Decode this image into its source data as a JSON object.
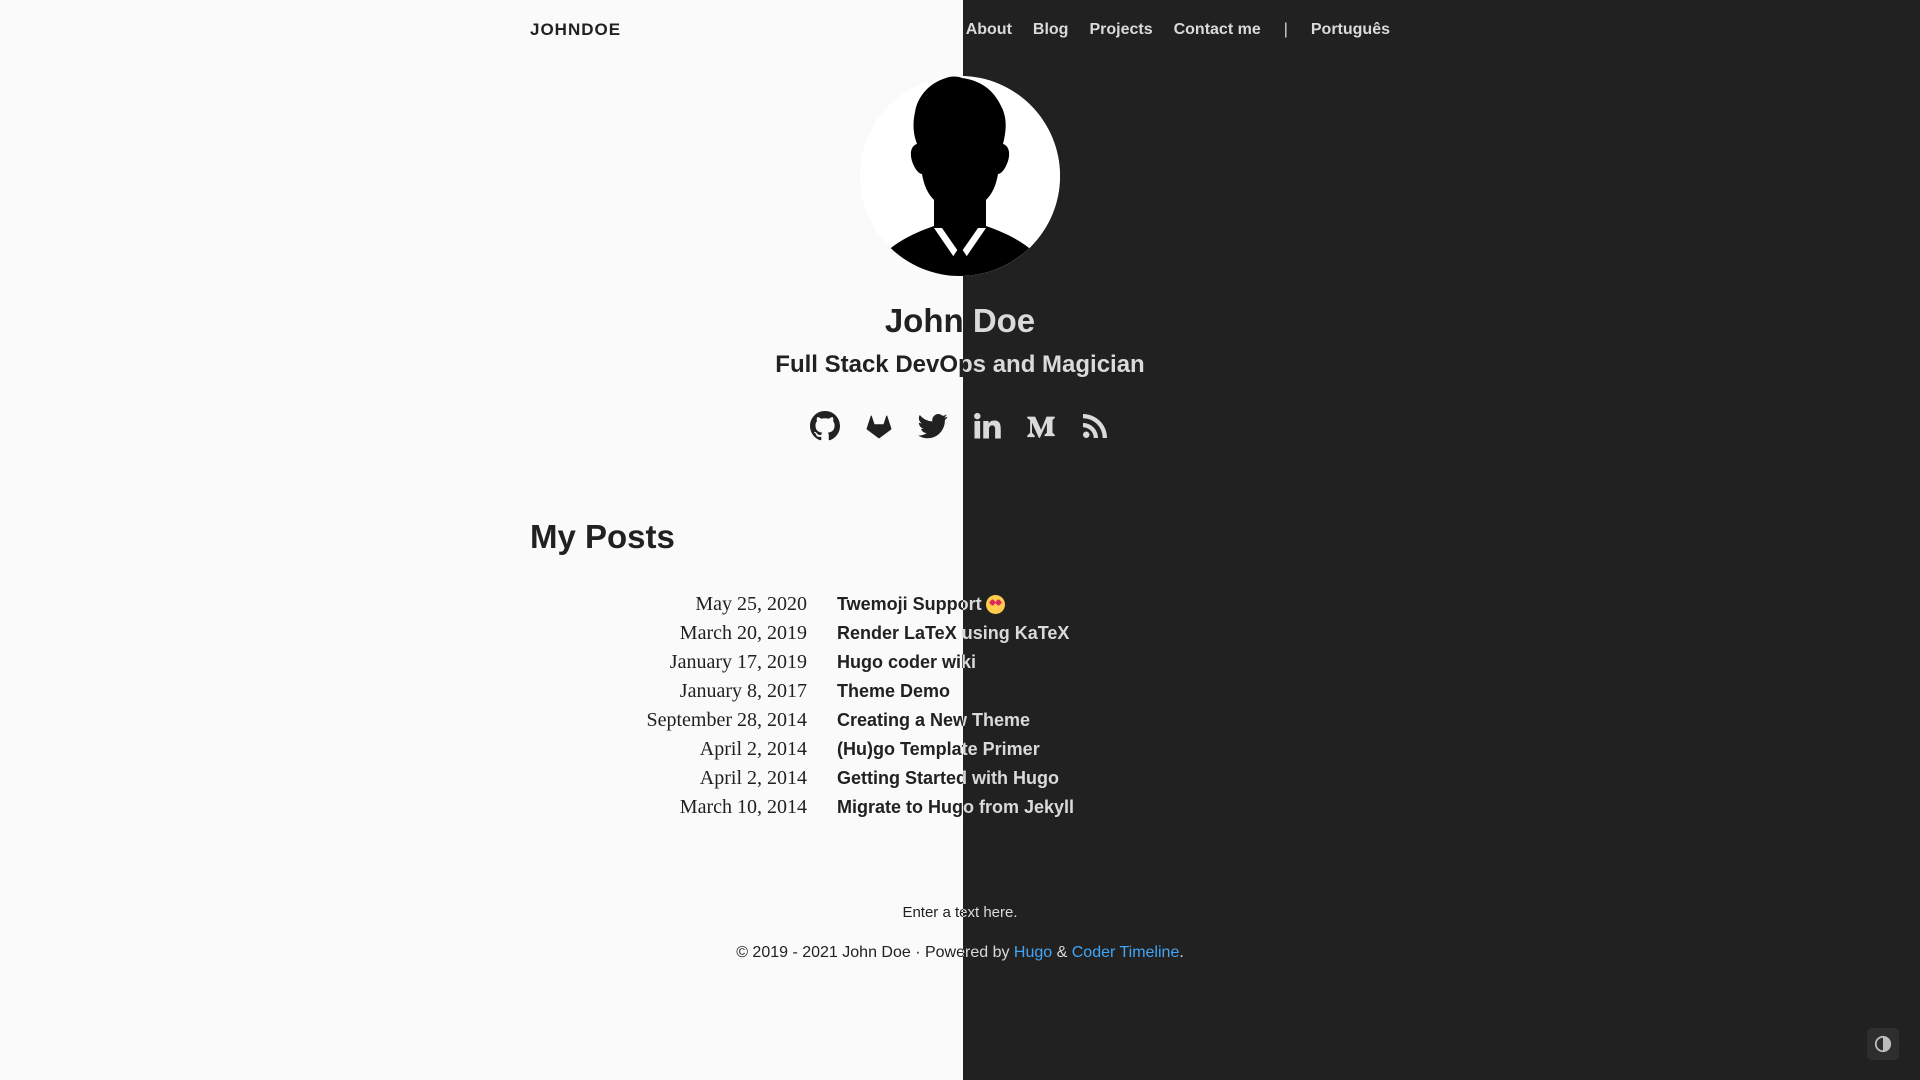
{
  "brand": "JOHNDOE",
  "nav": {
    "items": [
      "About",
      "Blog",
      "Projects",
      "Contact me"
    ],
    "separator": "|",
    "language": "Português"
  },
  "profile": {
    "name": "John Doe",
    "tagline": "Full Stack DevOps and Magician"
  },
  "social_icons": [
    "github-icon",
    "gitlab-icon",
    "twitter-icon",
    "linkedin-icon",
    "medium-icon",
    "rss-icon"
  ],
  "posts": {
    "heading": "My Posts",
    "items": [
      {
        "date": "May 25, 2020",
        "title": "Twemoji Support"
      },
      {
        "date": "March 20, 2019",
        "title": "Render LaTeX using KaTeX"
      },
      {
        "date": "January 17, 2019",
        "title": "Hugo coder wiki"
      },
      {
        "date": "January 8, 2017",
        "title": "Theme Demo"
      },
      {
        "date": "September 28, 2014",
        "title": "Creating a New Theme"
      },
      {
        "date": "April 2, 2014",
        "title": "(Hu)go Template Primer"
      },
      {
        "date": "April 2, 2014",
        "title": "Getting Started with Hugo"
      },
      {
        "date": "March 10, 2014",
        "title": "Migrate to Hugo from Jekyll"
      }
    ]
  },
  "footer": {
    "note": "Enter a text here.",
    "copy_prefix": "© 2019 - 2021 John Doe · Powered by ",
    "hugo_link": "Hugo",
    "amp": " & ",
    "theme_link": "Coder Timeline",
    "period": "."
  },
  "colors": {
    "light_bg": "#fafafa",
    "dark_bg": "#212121",
    "link_light": "#1565c0",
    "link_dark": "#42a5f5"
  }
}
